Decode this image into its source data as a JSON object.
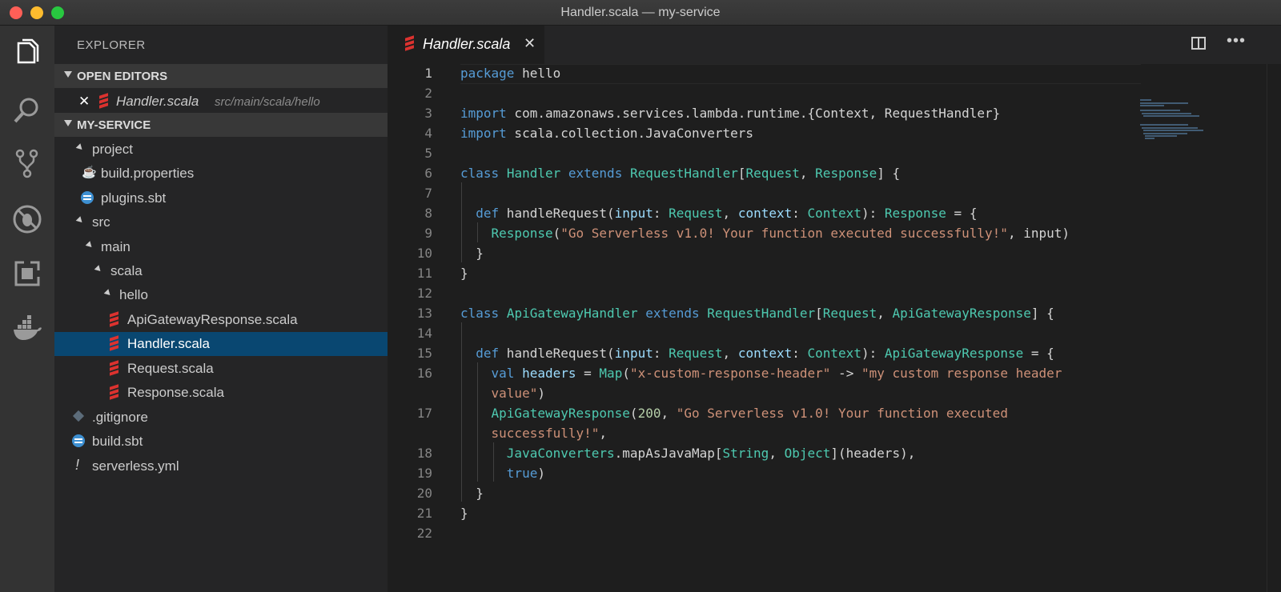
{
  "window": {
    "title": "Handler.scala — my-service"
  },
  "activity_bar": [
    {
      "name": "explorer-icon"
    },
    {
      "name": "search-icon"
    },
    {
      "name": "source-control-icon"
    },
    {
      "name": "debug-icon"
    },
    {
      "name": "extensions-icon"
    },
    {
      "name": "docker-icon"
    }
  ],
  "sidebar": {
    "title": "EXPLORER",
    "open_editors": {
      "header": "OPEN EDITORS",
      "items": [
        {
          "close": "✕",
          "name": "Handler.scala",
          "path": "src/main/scala/hello"
        }
      ]
    },
    "project": {
      "header": "MY-SERVICE",
      "tree": [
        {
          "label": "project",
          "kind": "folder"
        },
        {
          "label": "build.properties",
          "kind": "java"
        },
        {
          "label": "plugins.sbt",
          "kind": "sbt"
        },
        {
          "label": "src",
          "kind": "folder"
        },
        {
          "label": "main",
          "kind": "folder"
        },
        {
          "label": "scala",
          "kind": "folder"
        },
        {
          "label": "hello",
          "kind": "folder"
        },
        {
          "label": "ApiGatewayResponse.scala",
          "kind": "scala"
        },
        {
          "label": "Handler.scala",
          "kind": "scala",
          "selected": true
        },
        {
          "label": "Request.scala",
          "kind": "scala"
        },
        {
          "label": "Response.scala",
          "kind": "scala"
        },
        {
          "label": ".gitignore",
          "kind": "git"
        },
        {
          "label": "build.sbt",
          "kind": "sbt"
        },
        {
          "label": "serverless.yml",
          "kind": "yml"
        }
      ]
    }
  },
  "editor": {
    "tab": {
      "label": "Handler.scala",
      "close": "✕"
    },
    "line_numbers": [
      "1",
      "2",
      "3",
      "4",
      "5",
      "6",
      "7",
      "8",
      "9",
      "10",
      "11",
      "12",
      "13",
      "14",
      "15",
      "16",
      "17",
      "18",
      "19",
      "20",
      "21",
      "22"
    ],
    "current_line": "1",
    "code": {
      "l1_a": "package",
      "l1_b": " hello",
      "l3_a": "import",
      "l3_b": " com.amazonaws.services.lambda.runtime.{Context, RequestHandler}",
      "l4_a": "import",
      "l4_b": " scala.collection.JavaConverters",
      "l6_a": "class",
      "l6_b": "Handler",
      "l6_c": "extends",
      "l6_d": "RequestHandler",
      "l6_e": "Request",
      "l6_f": "Response",
      "l6_g": "] {",
      "l8_a": "def",
      "l8_b": " handleRequest(",
      "l8_c": "input",
      "l8_d": "Request",
      "l8_e": "context",
      "l8_f": "Context",
      "l8_g": "Response",
      "l8_h": " = {",
      "l9_a": "Response",
      "l9_b": "\"Go Serverless v1.0! Your function executed successfully!\"",
      "l9_c": ", input)",
      "l10": "}",
      "l11": "}",
      "l13_a": "class",
      "l13_b": "ApiGatewayHandler",
      "l13_c": "extends",
      "l13_d": "RequestHandler",
      "l13_e": "Request",
      "l13_f": "ApiGatewayResponse",
      "l13_g": "] {",
      "l15_a": "def",
      "l15_b": " handleRequest(",
      "l15_c": "input",
      "l15_d": "Request",
      "l15_e": "context",
      "l15_f": "Context",
      "l15_g": "ApiGatewayResponse",
      "l15_h": " = {",
      "l16_a": "val",
      "l16_b": "headers",
      "l16_c": "Map",
      "l16_d": "\"x-custom-response-header\"",
      "l16_e": " -> ",
      "l16_f": "\"my custom response header",
      "l16w_a": "value\"",
      "l16w_b": ")",
      "l17_a": "ApiGatewayResponse",
      "l17_b": "200",
      "l17_c": "\"Go Serverless v1.0! Your function executed",
      "l17w_a": "successfully!\"",
      "l17w_b": ",",
      "l18_a": "JavaConverters",
      "l18_b": ".mapAsJavaMap[",
      "l18_c": "String",
      "l18_d": "Object",
      "l18_e": "](headers),",
      "l19": "true",
      "l20": "}",
      "l21": "}"
    }
  },
  "colors": {
    "keyword": "#569cd6",
    "type": "#4ec9b0",
    "string": "#ce9178",
    "param": "#9cdcfe",
    "number": "#b5cea8",
    "selection": "#094771",
    "scala": "#dc322f"
  }
}
